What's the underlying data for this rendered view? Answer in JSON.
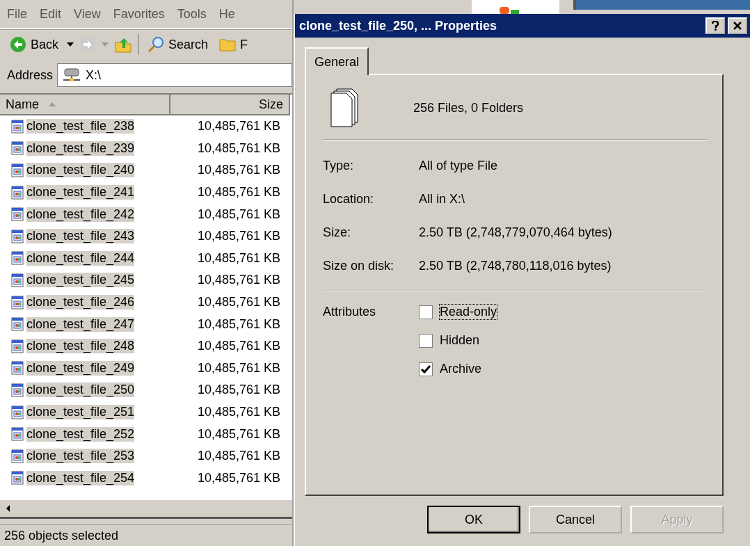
{
  "explorer": {
    "menu": [
      "File",
      "Edit",
      "View",
      "Favorites",
      "Tools",
      "He"
    ],
    "toolbar": {
      "back": "Back",
      "search": "Search",
      "folders": "F"
    },
    "address": {
      "label": "Address",
      "value": "X:\\"
    },
    "columns": [
      {
        "label": "Name",
        "sorted": true
      },
      {
        "label": "Size",
        "sorted": false
      }
    ],
    "rows": [
      {
        "name": "clone_test_file_238",
        "size": "10,485,761 KB",
        "selected": true
      },
      {
        "name": "clone_test_file_239",
        "size": "10,485,761 KB",
        "selected": true
      },
      {
        "name": "clone_test_file_240",
        "size": "10,485,761 KB",
        "selected": true
      },
      {
        "name": "clone_test_file_241",
        "size": "10,485,761 KB",
        "selected": true
      },
      {
        "name": "clone_test_file_242",
        "size": "10,485,761 KB",
        "selected": true
      },
      {
        "name": "clone_test_file_243",
        "size": "10,485,761 KB",
        "selected": true
      },
      {
        "name": "clone_test_file_244",
        "size": "10,485,761 KB",
        "selected": true
      },
      {
        "name": "clone_test_file_245",
        "size": "10,485,761 KB",
        "selected": true
      },
      {
        "name": "clone_test_file_246",
        "size": "10,485,761 KB",
        "selected": true
      },
      {
        "name": "clone_test_file_247",
        "size": "10,485,761 KB",
        "selected": true
      },
      {
        "name": "clone_test_file_248",
        "size": "10,485,761 KB",
        "selected": true
      },
      {
        "name": "clone_test_file_249",
        "size": "10,485,761 KB",
        "selected": true
      },
      {
        "name": "clone_test_file_250",
        "size": "10,485,761 KB",
        "selected": true
      },
      {
        "name": "clone_test_file_251",
        "size": "10,485,761 KB",
        "selected": true
      },
      {
        "name": "clone_test_file_252",
        "size": "10,485,761 KB",
        "selected": true
      },
      {
        "name": "clone_test_file_253",
        "size": "10,485,761 KB",
        "selected": true
      },
      {
        "name": "clone_test_file_254",
        "size": "10,485,761 KB",
        "selected": true
      }
    ],
    "status_bar": "256 objects selected"
  },
  "dialog": {
    "title": "clone_test_file_250, ... Properties",
    "tabs": [
      {
        "label": "General",
        "selected": true
      }
    ],
    "summary": "256 Files, 0 Folders",
    "properties": [
      {
        "label": "Type:",
        "value": "All of type File"
      },
      {
        "label": "Location:",
        "value": "All in X:\\"
      }
    ],
    "sizes": [
      {
        "label": "Size:",
        "value": "2.50 TB (2,748,779,070,464 bytes)"
      },
      {
        "label": "Size on disk:",
        "value": "2.50 TB (2,748,780,118,016 bytes)"
      }
    ],
    "attributes_label": "Attributes",
    "attributes": [
      {
        "label": "Read-only",
        "checked": false,
        "focused": true
      },
      {
        "label": "Hidden",
        "checked": false,
        "focused": false
      },
      {
        "label": "Archive",
        "checked": true,
        "focused": false
      }
    ],
    "buttons": [
      {
        "label": "OK",
        "default": true,
        "disabled": false
      },
      {
        "label": "Cancel",
        "default": false,
        "disabled": false
      },
      {
        "label": "Apply",
        "default": false,
        "disabled": true
      }
    ]
  }
}
